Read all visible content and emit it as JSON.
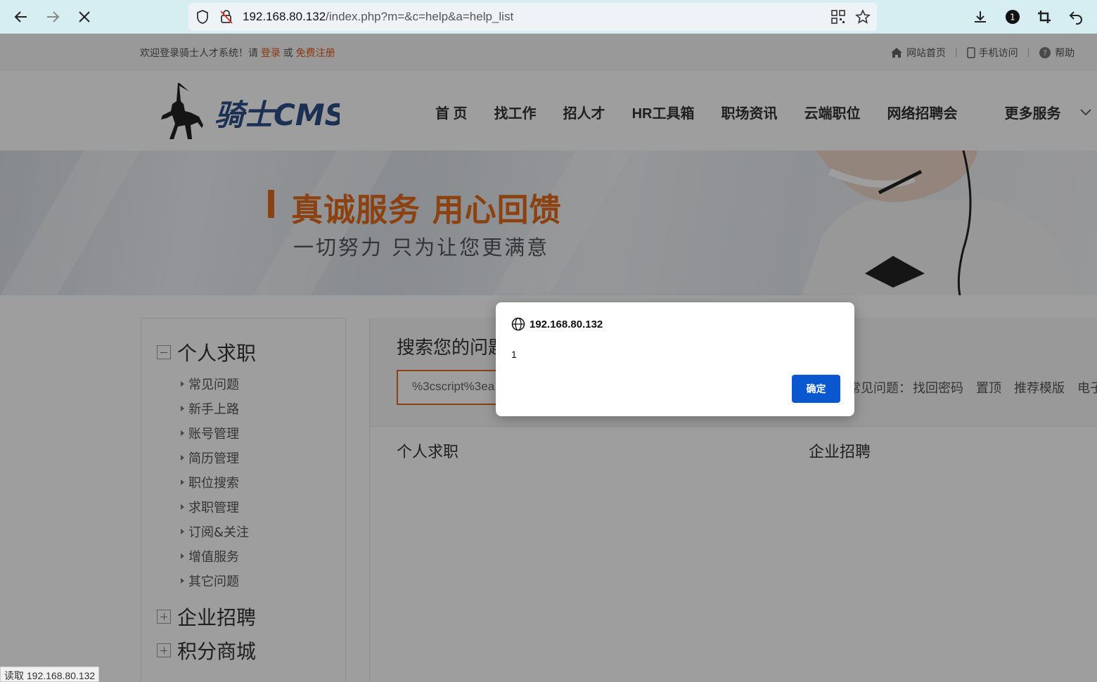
{
  "browser": {
    "url_host": "192.168.80.132",
    "url_path": "/index.php?m=&c=help&a=help_list",
    "tab_count": "1",
    "status_text": "读取 192.168.80.132"
  },
  "topbar": {
    "welcome": "欢迎登录骑士人才系统！请",
    "login": "登录",
    "or": "或",
    "register": "免费注册",
    "links": [
      "网站首页",
      "手机访问",
      "帮助"
    ]
  },
  "header": {
    "logo_text": "骑士CMS",
    "nav": [
      "首 页",
      "找工作",
      "招人才",
      "HR工具箱",
      "职场资讯",
      "云端职位",
      "网络招聘会"
    ],
    "more": "更多服务"
  },
  "banner": {
    "headline": "真诚服务 用心回馈",
    "subline": "一切努力 只为让您更满意"
  },
  "sidebar": {
    "categories": [
      {
        "label": "个人求职",
        "expanded": true
      },
      {
        "label": "企业招聘",
        "expanded": false
      },
      {
        "label": "积分商城",
        "expanded": false
      }
    ],
    "items": [
      "常见问题",
      "新手上路",
      "账号管理",
      "简历管理",
      "职位搜索",
      "求职管理",
      "订阅&关注",
      "增值服务",
      "其它问题"
    ]
  },
  "main": {
    "search_title": "搜索您的问题",
    "search_value": "%3cscript%3ea",
    "hot_label": "常见问题：",
    "hot_items": [
      "找回密码",
      "置顶",
      "推荐模版",
      "电子"
    ],
    "sections": [
      "个人求职",
      "企业招聘"
    ]
  },
  "dialog": {
    "origin": "192.168.80.132",
    "message": "1",
    "ok_label": "确定"
  },
  "colors": {
    "accent": "#e2691c",
    "dialog_button": "#0b57d0",
    "chrome_bg": "#d6edf1"
  }
}
